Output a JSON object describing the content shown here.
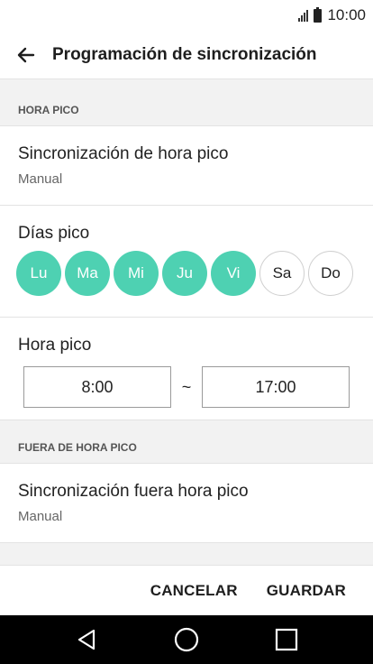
{
  "status_bar": {
    "time": "10:00",
    "signal_icon": "signal-icon",
    "battery_icon": "battery-icon"
  },
  "app_bar": {
    "back_icon": "arrow-back-icon",
    "title": "Programación de sincronización"
  },
  "peak_section": {
    "header": "HORA PICO",
    "sync": {
      "title": "Sincronización de hora pico",
      "value": "Manual"
    },
    "days": {
      "title": "Días pico",
      "items": [
        {
          "label": "Lu",
          "selected": true
        },
        {
          "label": "Ma",
          "selected": true
        },
        {
          "label": "Mi",
          "selected": true
        },
        {
          "label": "Ju",
          "selected": true
        },
        {
          "label": "Vi",
          "selected": true
        },
        {
          "label": "Sa",
          "selected": false
        },
        {
          "label": "Do",
          "selected": false
        }
      ]
    },
    "hours": {
      "title": "Hora pico",
      "start": "8:00",
      "separator": "~",
      "end": "17:00"
    }
  },
  "offpeak_section": {
    "header": "FUERA DE HORA PICO",
    "sync": {
      "title": "Sincronización fuera hora pico",
      "value": "Manual"
    }
  },
  "footer": {
    "cancel_label": "CANCELAR",
    "save_label": "GUARDAR"
  },
  "nav_bar": {
    "back_icon": "nav-back-icon",
    "home_icon": "nav-home-icon",
    "recents_icon": "nav-recents-icon"
  },
  "colors": {
    "accent": "#4ed1b2",
    "background": "#f2f2f2",
    "nav_bar": "#000000"
  }
}
